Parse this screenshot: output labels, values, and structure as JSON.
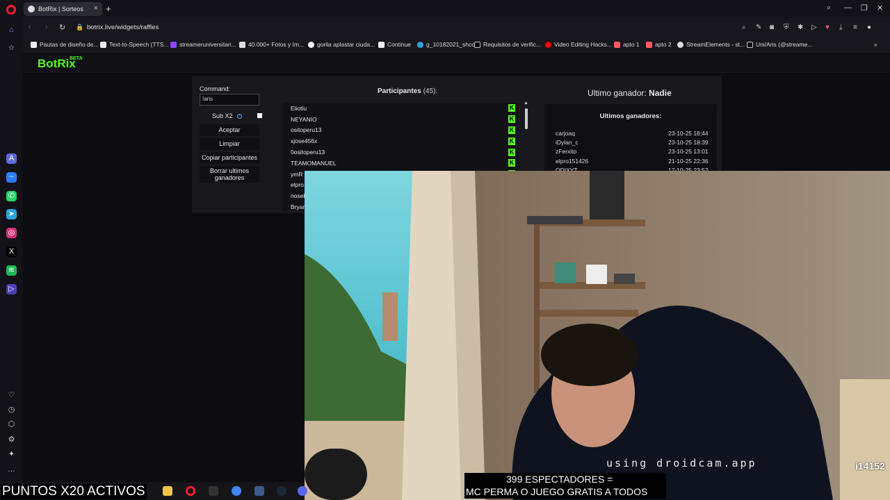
{
  "browser": {
    "tab_title": "BotRix | Sorteos",
    "url": "botrix.live/widgets/raffles",
    "bookmarks": [
      "Pautas de diseño de...",
      "Text-to-Speech (TTS...",
      "streameruniversitari...",
      "40.000+ Fotos y Im...",
      "gorila aplastar ciuda...",
      "Continue",
      "g_10182021_shcc",
      "Requisitos de verific...",
      "Video Editing Hacks...",
      "apto 1",
      "apto 2",
      "StreamElements - st...",
      "Uni/Aris (@streame..."
    ]
  },
  "app": {
    "logo": "BotRix",
    "beta": "BETA"
  },
  "raffle": {
    "command_label": "Command:",
    "command_value": "!aris",
    "sub_label": "Sub X2",
    "buttons": {
      "accept": "Aceptar",
      "clear": "Limpiar",
      "copy": "Copiar participantes",
      "delete_winners": "Borrar ultimos ganadores"
    },
    "participants_label": "Participantes",
    "participants_count": "(45):",
    "participants": [
      "Eliotiu",
      "NEYANIO",
      "ositoperu13",
      "xjose456x",
      "0ositoperu13",
      "TEAMOMANUEL",
      "ymR",
      "elpro",
      "nosek",
      "Bryan"
    ],
    "last_winner_label": "Ultimo ganador:",
    "last_winner_value": "Nadie",
    "winners_title": "Ultimos ganadores:",
    "winners": [
      {
        "name": "carjoaq",
        "date": "23-10-25 18:44"
      },
      {
        "name": "iDylan_c",
        "date": "23-10-25 18:39"
      },
      {
        "name": "zFerxito",
        "date": "23-10-25 13:01"
      },
      {
        "name": "elpro151426",
        "date": "21-10-25 22:36"
      },
      {
        "name": "ODIXYT",
        "date": "17-10-25 23:52"
      }
    ]
  },
  "stream": {
    "cam_caption": "using droidcam.app",
    "viewer_number": "i14152",
    "overlay_line1": "399 ESPECTADORES =",
    "overlay_line2": "MC PERMA O JUEGO GRATIS A TODOS",
    "puntos": "PUNTOS X20 ACTIVOS"
  },
  "colors": {
    "kick_green": "#53fc18",
    "opera_red": "#ff1b2d"
  }
}
